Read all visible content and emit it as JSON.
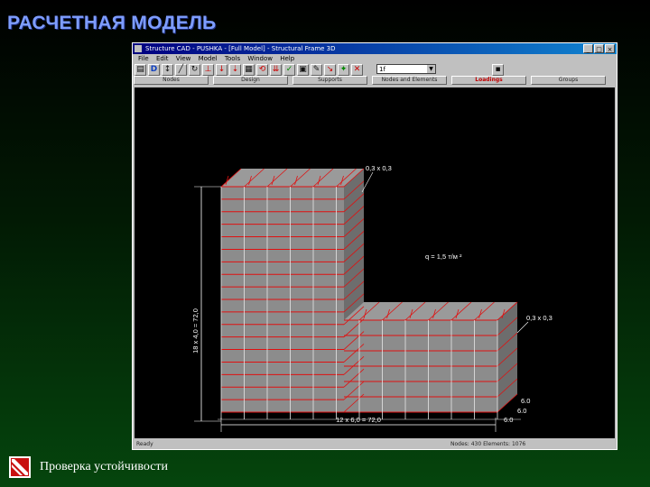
{
  "slide": {
    "title": "РАСЧЕТНАЯ МОДЕЛЬ",
    "footer_text": "Проверка устойчивости"
  },
  "window": {
    "title": "Structure CAD - PUSHKA - [Full Model] - Structural Frame 3D",
    "menu": [
      "File",
      "Edit",
      "View",
      "Model",
      "Tools",
      "Window",
      "Help"
    ],
    "controls": [
      "_",
      "□",
      "×"
    ],
    "combo_value": "1f",
    "tabs": [
      {
        "label": "Nodes",
        "active": false
      },
      {
        "label": "Design",
        "active": false
      },
      {
        "label": "Supports",
        "active": false
      },
      {
        "label": "Nodes and Elements",
        "active": false
      },
      {
        "label": "Loadings",
        "active": true
      },
      {
        "label": "Groups",
        "active": false
      }
    ],
    "status_left": "Ready",
    "status_right": "Nodes: 430  Elements: 1076"
  },
  "model": {
    "column_section_upper": "0,3 x 0,3",
    "column_section_lower": "0,3 x 0,3",
    "load": "q = 1,5 т/м ²",
    "height_dim": "18 x 4,0 = 72,0",
    "length_dim": "12 x 6,0 = 72,0",
    "depth_dims": [
      "6.0",
      "6.0",
      "6.0"
    ]
  },
  "colors": {
    "title": "#7e9dff",
    "frame_red": "#e01010",
    "slab_gray": "#8c8c8c",
    "column_white": "#e8e8e8"
  },
  "icons": [
    "app-icon",
    "open-icon",
    "bold-d-icon",
    "node-icon",
    "rotate-icon",
    "save-icon",
    "support-icon",
    "load-icon",
    "delete-icon"
  ]
}
